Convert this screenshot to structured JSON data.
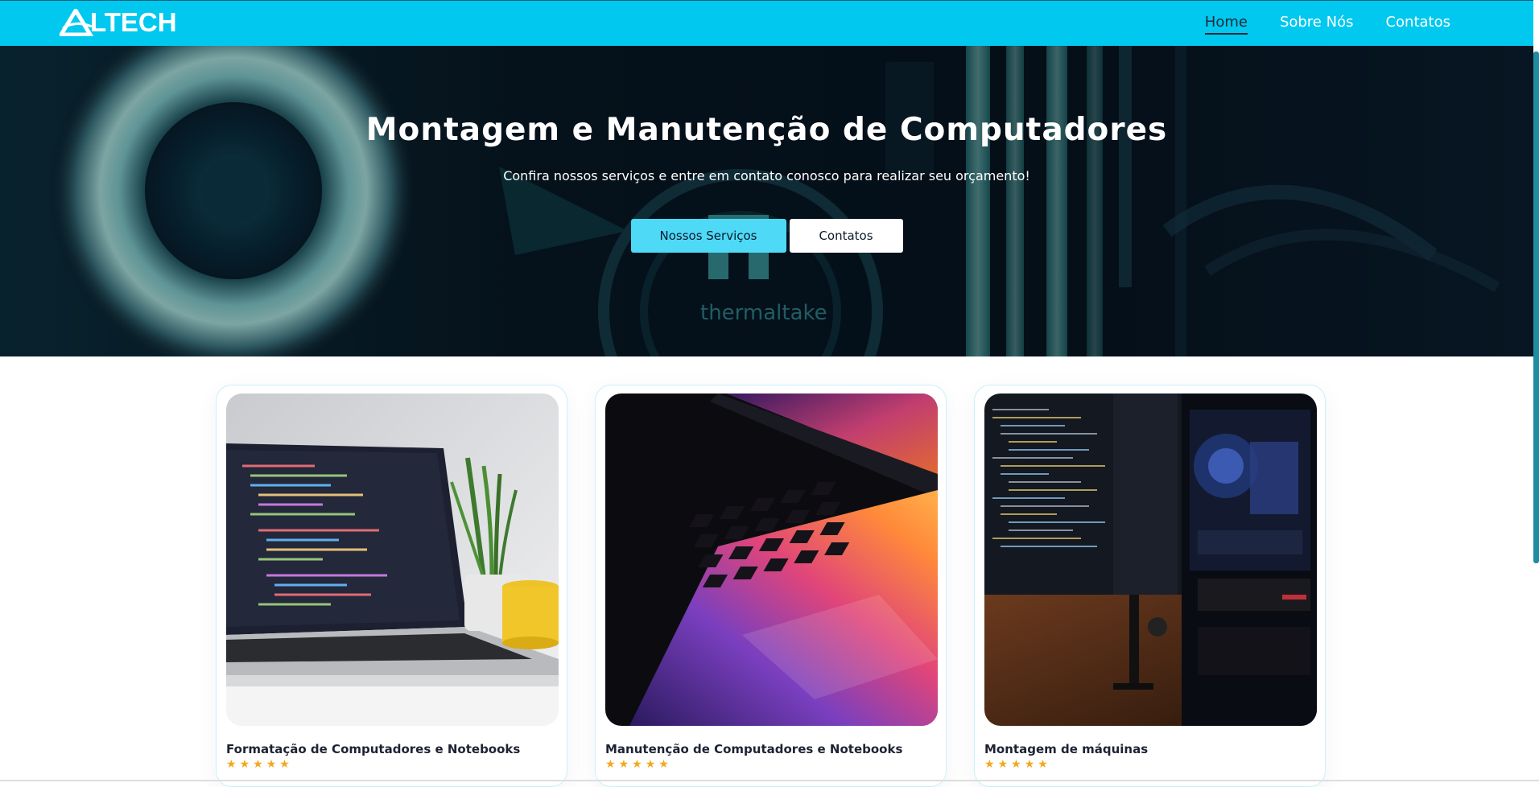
{
  "brand": {
    "name": "LTECH",
    "logo_icon": "altech-a-logo"
  },
  "nav": {
    "items": [
      {
        "label": "Home",
        "active": true
      },
      {
        "label": "Sobre Nós",
        "active": false
      },
      {
        "label": "Contatos",
        "active": false
      }
    ]
  },
  "hero": {
    "title": "Montagem e Manutenção de Computadores",
    "subtitle": "Confira nossos serviços e entre em contato conosco para realizar seu orçamento!",
    "primary_button": "Nossos Serviços",
    "secondary_button": "Contatos",
    "background_brand_text": "thermaltake"
  },
  "services": [
    {
      "title": "Formatação de Computadores e Notebooks",
      "rating": 5
    },
    {
      "title": "Manutenção de Computadores e Notebooks",
      "rating": 5
    },
    {
      "title": "Montagem de máquinas",
      "rating": 5
    }
  ],
  "colors": {
    "navbar": "#00c8ef",
    "primary_button": "#4ed9f6",
    "star": "#f3a81c",
    "active_nav": "#1e2a3a"
  }
}
